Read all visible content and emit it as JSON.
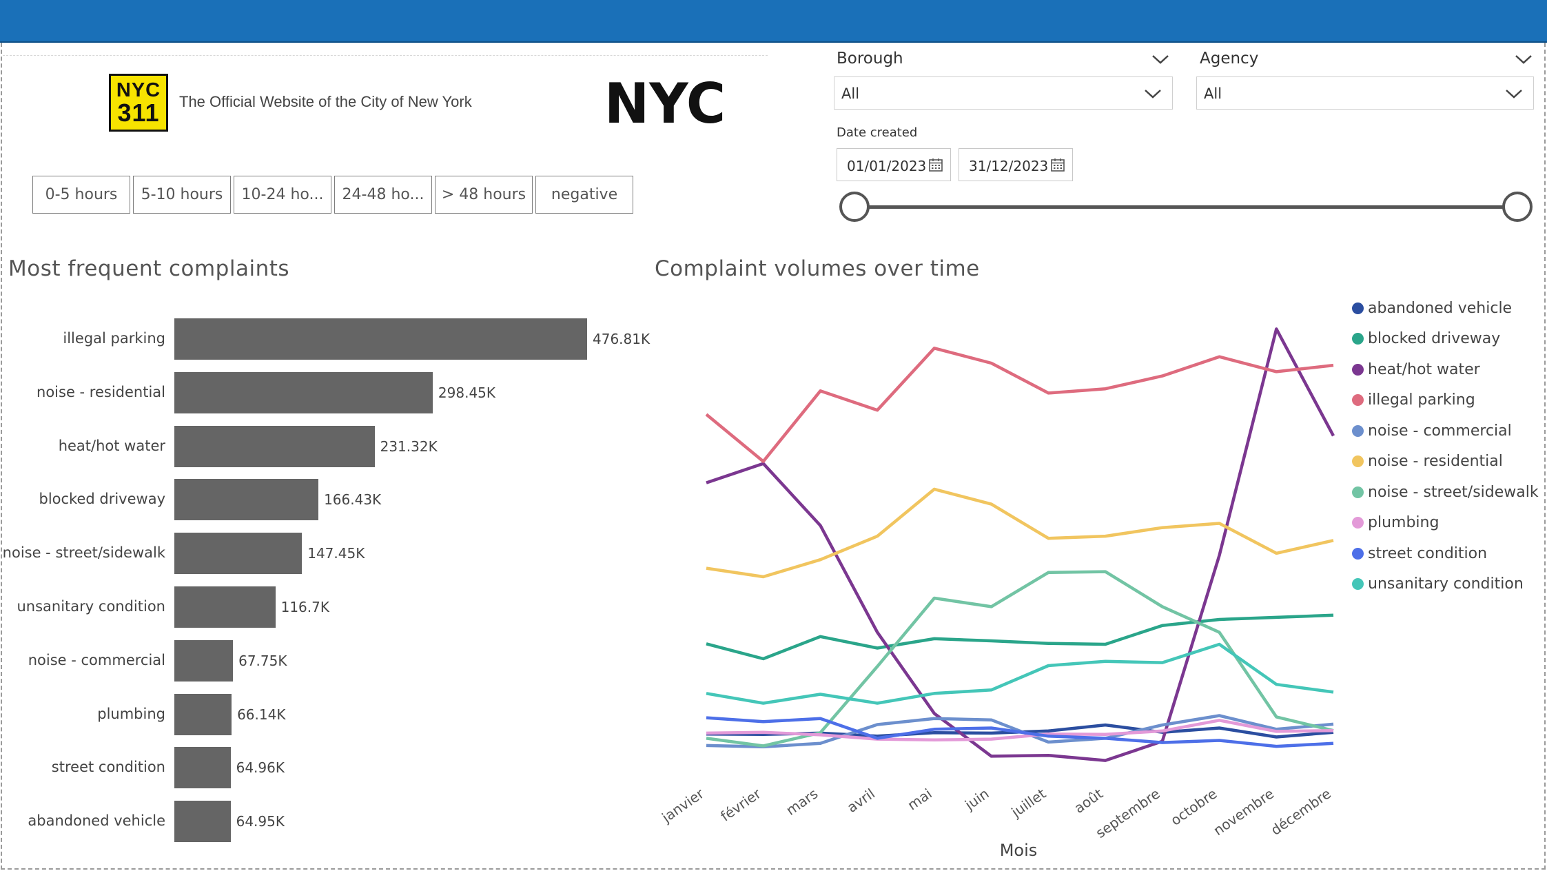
{
  "header": {
    "logo_311_line1": "NYC",
    "logo_311_line2": "311",
    "tagline": "The Official Website of the City of New York",
    "nyc_logo_text": "NYC"
  },
  "time_buttons": [
    {
      "label": "0-5 hours"
    },
    {
      "label": "5-10 hours"
    },
    {
      "label": "10-24 ho..."
    },
    {
      "label": "24-48 ho..."
    },
    {
      "label": "> 48 hours"
    },
    {
      "label": "negative"
    }
  ],
  "filters": {
    "borough": {
      "label": "Borough",
      "value": "All"
    },
    "agency": {
      "label": "Agency",
      "value": "All"
    },
    "date": {
      "label": "Date created",
      "start": "01/01/2023",
      "end": "31/12/2023"
    }
  },
  "bar_chart_title": "Most frequent complaints",
  "line_chart_title": "Complaint volumes over time",
  "colors": {
    "topbar": "#1a70b8",
    "bar": "#656565"
  },
  "chart_data": [
    {
      "type": "bar",
      "orientation": "horizontal",
      "title": "Most frequent complaints",
      "categories": [
        "illegal parking",
        "noise - residential",
        "heat/hot water",
        "blocked driveway",
        "noise - street/sidewalk",
        "unsanitary condition",
        "noise - commercial",
        "plumbing",
        "street condition",
        "abandoned vehicle"
      ],
      "values": [
        476810,
        298450,
        231320,
        166430,
        147450,
        116700,
        67750,
        66140,
        64960,
        64950
      ],
      "value_labels": [
        "476.81K",
        "298.45K",
        "231.32K",
        "166.43K",
        "147.45K",
        "116.7K",
        "67.75K",
        "66.14K",
        "64.96K",
        "64.95K"
      ]
    },
    {
      "type": "line",
      "title": "Complaint volumes over time",
      "xlabel": "Mois",
      "x": [
        "janvier",
        "février",
        "mars",
        "avril",
        "mai",
        "juin",
        "juillet",
        "août",
        "septembre",
        "octobre",
        "novembre",
        "décembre"
      ],
      "ylim": [
        0,
        100000
      ],
      "legend_position": "right",
      "series": [
        {
          "name": "abandoned vehicle",
          "color": "#2b4ea0",
          "values": [
            3200,
            3100,
            3400,
            2700,
            3500,
            3400,
            3900,
            5300,
            3600,
            4600,
            2500,
            3600
          ]
        },
        {
          "name": "blocked driveway",
          "color": "#2aa58a",
          "values": [
            24300,
            20800,
            26000,
            23300,
            25500,
            25000,
            24400,
            24200,
            28600,
            30000,
            30500,
            31000
          ]
        },
        {
          "name": "heat/hot water",
          "color": "#7b3790",
          "values": [
            62000,
            66500,
            52000,
            27000,
            8000,
            -2000,
            -1800,
            -3000,
            1500,
            45000,
            98000,
            73000
          ]
        },
        {
          "name": "illegal parking",
          "color": "#de6b7e",
          "values": [
            78000,
            67000,
            83500,
            79000,
            93500,
            90000,
            83000,
            84000,
            87000,
            91500,
            88000,
            89500
          ]
        },
        {
          "name": "noise - commercial",
          "color": "#6c8fcd",
          "values": [
            500,
            200,
            1000,
            5400,
            6800,
            6500,
            1300,
            2200,
            5300,
            7500,
            4300,
            5500
          ]
        },
        {
          "name": "noise - residential",
          "color": "#f1c55f",
          "values": [
            42000,
            40000,
            44000,
            49500,
            60500,
            57000,
            49000,
            49500,
            51500,
            52500,
            45500,
            48500
          ]
        },
        {
          "name": "noise - street/sidewalk",
          "color": "#72c4a4",
          "values": [
            2200,
            400,
            3500,
            19000,
            35000,
            33000,
            41000,
            41200,
            33000,
            27000,
            7200,
            4000
          ]
        },
        {
          "name": "plumbing",
          "color": "#e39ad8",
          "values": [
            3400,
            3600,
            3000,
            2000,
            1800,
            2000,
            3200,
            3100,
            3900,
            6400,
            3800,
            4000
          ]
        },
        {
          "name": "street condition",
          "color": "#4d6fe8",
          "values": [
            7000,
            6100,
            6800,
            2200,
            4300,
            4600,
            2700,
            2200,
            1200,
            1700,
            300,
            1000
          ]
        },
        {
          "name": "unsanitary condition",
          "color": "#44c6b8",
          "values": [
            12700,
            10400,
            12500,
            10400,
            12700,
            13500,
            19200,
            20200,
            19900,
            24200,
            14800,
            13000
          ]
        }
      ]
    }
  ]
}
